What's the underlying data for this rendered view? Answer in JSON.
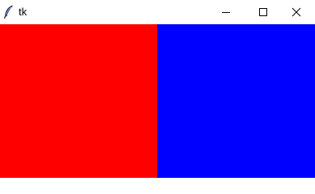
{
  "window": {
    "title": "tk",
    "app_icon": "feather-icon",
    "controls": {
      "minimize_icon": "minimize-icon",
      "maximize_icon": "maximize-icon",
      "close_icon": "close-icon"
    }
  },
  "content": {
    "left_pane_color": "#ff0000",
    "right_pane_color": "#0000ff"
  }
}
